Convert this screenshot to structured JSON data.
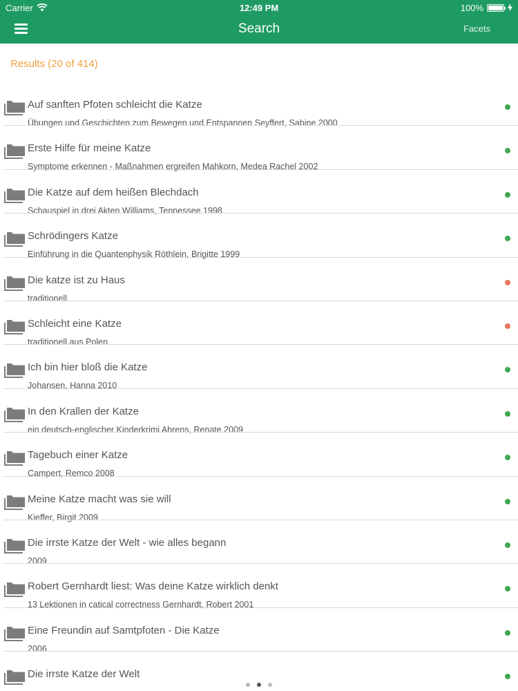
{
  "status_bar": {
    "carrier": "Carrier",
    "time": "12:49 PM",
    "battery": "100%",
    "battery_level": 1.0
  },
  "nav": {
    "menu_icon": "hamburger-menu-icon",
    "title": "Search",
    "facets_label": "Facets"
  },
  "results": {
    "count_label": "Results (20 of 414)"
  },
  "colors": {
    "brand_green": "#1e9b63",
    "status_available": "#3fa751",
    "status_unavailable": "#e8755a",
    "results_orange": "#f0a040"
  },
  "items": [
    {
      "title": "Auf sanften Pfoten schleicht die Katze",
      "subtitle": "Übungen und Geschichten zum Bewegen und Entspannen Seyffert, Sabine 2000",
      "status": "available"
    },
    {
      "title": "Erste Hilfe für meine Katze",
      "subtitle": "Symptome erkennen - Maßnahmen ergreifen Mahkorn, Medea Rachel 2002",
      "status": "available"
    },
    {
      "title": "Die Katze auf dem heißen Blechdach",
      "subtitle": "Schauspiel in drei Akten Williams, Tennessee 1998",
      "status": "available"
    },
    {
      "title": "Schrödingers Katze",
      "subtitle": "Einführung in die Quantenphysik Röthlein, Brigitte 1999",
      "status": "available"
    },
    {
      "title": "Die katze ist zu Haus",
      "subtitle": "traditionell",
      "status": "unavailable"
    },
    {
      "title": "Schleicht eine Katze",
      "subtitle": "traditionell aus Polen",
      "status": "unavailable"
    },
    {
      "title": "Ich bin hier bloß die Katze",
      "subtitle": "Johansen, Hanna 2010",
      "status": "available"
    },
    {
      "title": "In den Krallen der Katze",
      "subtitle": "ein deutsch-englischer Kinderkrimi Ahrens, Renate 2009",
      "status": "available"
    },
    {
      "title": "Tagebuch einer Katze",
      "subtitle": "Campert, Remco 2008",
      "status": "available"
    },
    {
      "title": "Meine Katze macht was sie will",
      "subtitle": "Kieffer, Birgit 2009",
      "status": "available"
    },
    {
      "title": "Die irrste Katze der Welt - wie alles begann",
      "subtitle": "2009",
      "status": "available"
    },
    {
      "title": "Robert Gernhardt liest: Was deine Katze wirklich denkt",
      "subtitle": "13 Lektionen in catical correctness Gernhardt, Robert 2001",
      "status": "available"
    },
    {
      "title": "Eine Freundin auf Samtpfoten - Die Katze",
      "subtitle": "2006",
      "status": "available"
    },
    {
      "title": "Die irrste Katze der Welt",
      "subtitle": "",
      "status": "available"
    }
  ],
  "pager": {
    "pages": 3,
    "active": 1
  }
}
